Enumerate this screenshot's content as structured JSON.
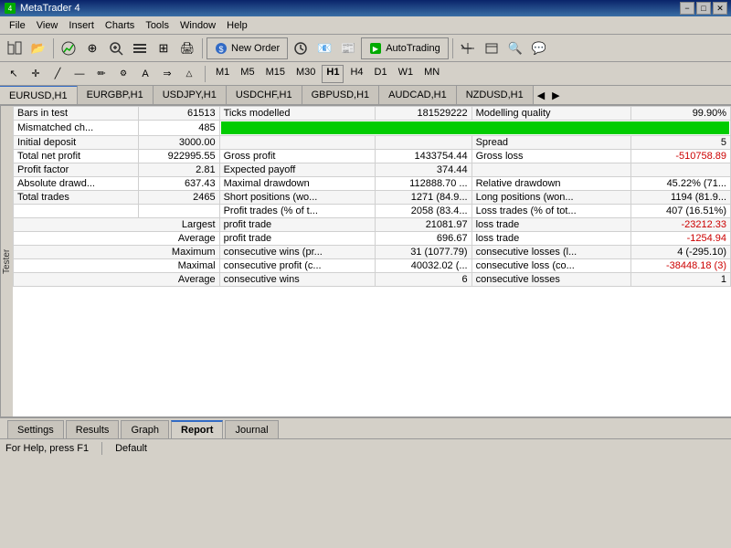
{
  "titleBar": {
    "title": "MetaTrader 4",
    "minLabel": "−",
    "maxLabel": "□",
    "closeLabel": "✕"
  },
  "menuBar": {
    "items": [
      "File",
      "View",
      "Insert",
      "Charts",
      "Tools",
      "Window",
      "Help"
    ]
  },
  "toolbar": {
    "newOrderLabel": "New Order",
    "autoTradingLabel": "AutoTrading"
  },
  "timeframes": [
    "M1",
    "M5",
    "M15",
    "M30",
    "H1",
    "H4",
    "D1",
    "W1",
    "MN"
  ],
  "chartTabs": {
    "tabs": [
      {
        "label": "EURUSD,H1",
        "active": true
      },
      {
        "label": "EURGBP,H1"
      },
      {
        "label": "USDJPY,H1"
      },
      {
        "label": "USDCHF,H1"
      },
      {
        "label": "GBPUSD,H1"
      },
      {
        "label": "AUDCAD,H1"
      },
      {
        "label": "NZDUSD,H1"
      }
    ]
  },
  "report": {
    "rows": [
      {
        "col1_label": "Bars in test",
        "col1_value": "61513",
        "col2_label": "Ticks modelled",
        "col2_value": "181529222",
        "col3_label": "Modelling quality",
        "col3_value": "99.90%",
        "col3_type": "quality"
      },
      {
        "col1_label": "Mismatched ch...",
        "col1_value": "485",
        "col2_label": "",
        "col2_value": "",
        "col3_label": "",
        "col3_value": "",
        "col3_type": "greenbar"
      },
      {
        "col1_label": "Initial deposit",
        "col1_value": "3000.00",
        "col2_label": "",
        "col2_value": "",
        "col3_label": "Spread",
        "col3_value": "5"
      },
      {
        "col1_label": "Total net profit",
        "col1_value": "922995.55",
        "col2_label": "Gross profit",
        "col2_value": "1433754.44",
        "col3_label": "Gross loss",
        "col3_value": "-510758.89",
        "col3_red": true
      },
      {
        "col1_label": "Profit factor",
        "col1_value": "2.81",
        "col2_label": "Expected payoff",
        "col2_value": "374.44",
        "col3_label": "",
        "col3_value": ""
      },
      {
        "col1_label": "Absolute drawd...",
        "col1_value": "637.43",
        "col2_label": "Maximal drawdown",
        "col2_value": "112888.70 ...",
        "col3_label": "Relative drawdown",
        "col3_value": "45.22% (71..."
      },
      {
        "col1_label": "Total trades",
        "col1_value": "2465",
        "col2_label": "Short positions (wo...",
        "col2_value": "1271 (84.9...",
        "col3_label": "Long positions (won...",
        "col3_value": "1194 (81.9..."
      },
      {
        "col1_label": "",
        "col1_value": "",
        "col2_label": "Profit trades (% of t...",
        "col2_value": "2058 (83.4...",
        "col3_label": "Loss trades (% of tot...",
        "col3_value": "407 (16.51%)"
      },
      {
        "col1_label": "",
        "col1_right": "Largest",
        "col2_label": "profit trade",
        "col2_value": "21081.97",
        "col3_label": "loss trade",
        "col3_value": "-23212.33",
        "col3_red": true
      },
      {
        "col1_label": "",
        "col1_right": "Average",
        "col2_label": "profit trade",
        "col2_value": "696.67",
        "col3_label": "loss trade",
        "col3_value": "-1254.94",
        "col3_red": true
      },
      {
        "col1_label": "",
        "col1_right": "Maximum",
        "col2_label": "consecutive wins (pr...",
        "col2_value": "31 (1077.79)",
        "col3_label": "consecutive losses (l...",
        "col3_value": "4 (-295.10)"
      },
      {
        "col1_label": "",
        "col1_right": "Maximal",
        "col2_label": "consecutive profit (c...",
        "col2_value": "40032.02 (...",
        "col3_label": "consecutive loss (co...",
        "col3_value": "-38448.18 (3)"
      },
      {
        "col1_label": "",
        "col1_right": "Average",
        "col2_label": "consecutive wins",
        "col2_value": "6",
        "col3_label": "consecutive losses",
        "col3_value": "1"
      }
    ]
  },
  "bottomTabs": {
    "tabs": [
      {
        "label": "Settings"
      },
      {
        "label": "Results"
      },
      {
        "label": "Graph"
      },
      {
        "label": "Report",
        "active": true
      },
      {
        "label": "Journal"
      }
    ]
  },
  "statusBar": {
    "helpText": "For Help, press F1",
    "defaultText": "Default"
  },
  "testerLabel": "Tester"
}
